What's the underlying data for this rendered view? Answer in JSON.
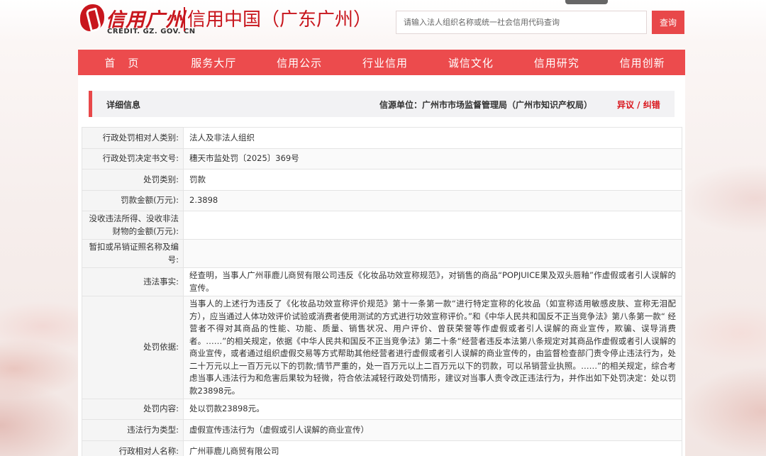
{
  "header": {
    "logo_cn": "信用广州",
    "logo_en": "CREDIT. GZ. GOV. CN",
    "logo_sub": "信用中国（广东广州）",
    "search_placeholder": "请输入法人组织名称或统一社会信用代码查询",
    "search_button": "查询"
  },
  "nav": {
    "items": [
      "首页",
      "服务大厅",
      "信用公示",
      "行业信用",
      "诚信文化",
      "信用研究",
      "信用创新"
    ]
  },
  "info_bar": {
    "title": "详细信息",
    "source": "信源单位：广州市市场监督管理局（广州市知识产权局）",
    "objection": "异议 / 纠错"
  },
  "details": [
    {
      "label": "行政处罚相对人类别:",
      "value": "法人及非法人组织"
    },
    {
      "label": "行政处罚决定书文号:",
      "value": "穗天市监处罚〔2025〕369号"
    },
    {
      "label": "处罚类别:",
      "value": "罚款"
    },
    {
      "label": "罚款金额(万元):",
      "value": "2.3898"
    },
    {
      "label": "没收违法所得、没收非法财物的金额(万元):",
      "value": ""
    },
    {
      "label": "暂扣或吊销证照名称及编号:",
      "value": ""
    },
    {
      "label": "违法事实:",
      "value": "经查明，当事人广州菲鹿儿商贸有限公司违反《化妆品功效宣称规范》，对销售的商品“POPJUICE果及双头唇釉”作虚假或者引人误解的宣传。"
    },
    {
      "label": "处罚依据:",
      "value": "当事人的上述行为违反了《化妆品功效宣称评价规范》第十一条第一款“进行特定宣称的化妆品（如宣称适用敏感皮肤、宣称无泪配方），应当通过人体功效评价试验或消费者使用测试的方式进行功效宣称评价。”和《中华人民共和国反不正当竞争法》第八条第一款“ 经营者不得对其商品的性能、功能、质量、销售状况、用户评价、曾获荣誉等作虚假或者引人误解的商业宣传，欺骗、误导消费者。……”的相关规定，依据《中华人民共和国反不正当竞争法》第二十条“经营者违反本法第八条规定对其商品作虚假或者引人误解的商业宣传，或者通过组织虚假交易等方式帮助其他经营者进行虚假或者引人误解的商业宣传的，由监督检查部门责令停止违法行为，处二十万元以上一百万元以下的罚款;情节严重的，处一百万元以上二百万元以下的罚款，可以吊销营业执照。……”的相关规定，综合考虑当事人违法行为和危害后果较为轻微，符合依法减轻行政处罚情形，建议对当事人责令改正违法行为，并作出如下处罚决定：处以罚款23898元。"
    },
    {
      "label": "处罚内容:",
      "value": "处以罚款23898元。"
    },
    {
      "label": "违法行为类型:",
      "value": "虚假宣传违法行为（虚假或引人误解的商业宣传）"
    },
    {
      "label": "行政相对人名称:",
      "value": "广州菲鹿儿商贸有限公司"
    }
  ]
}
